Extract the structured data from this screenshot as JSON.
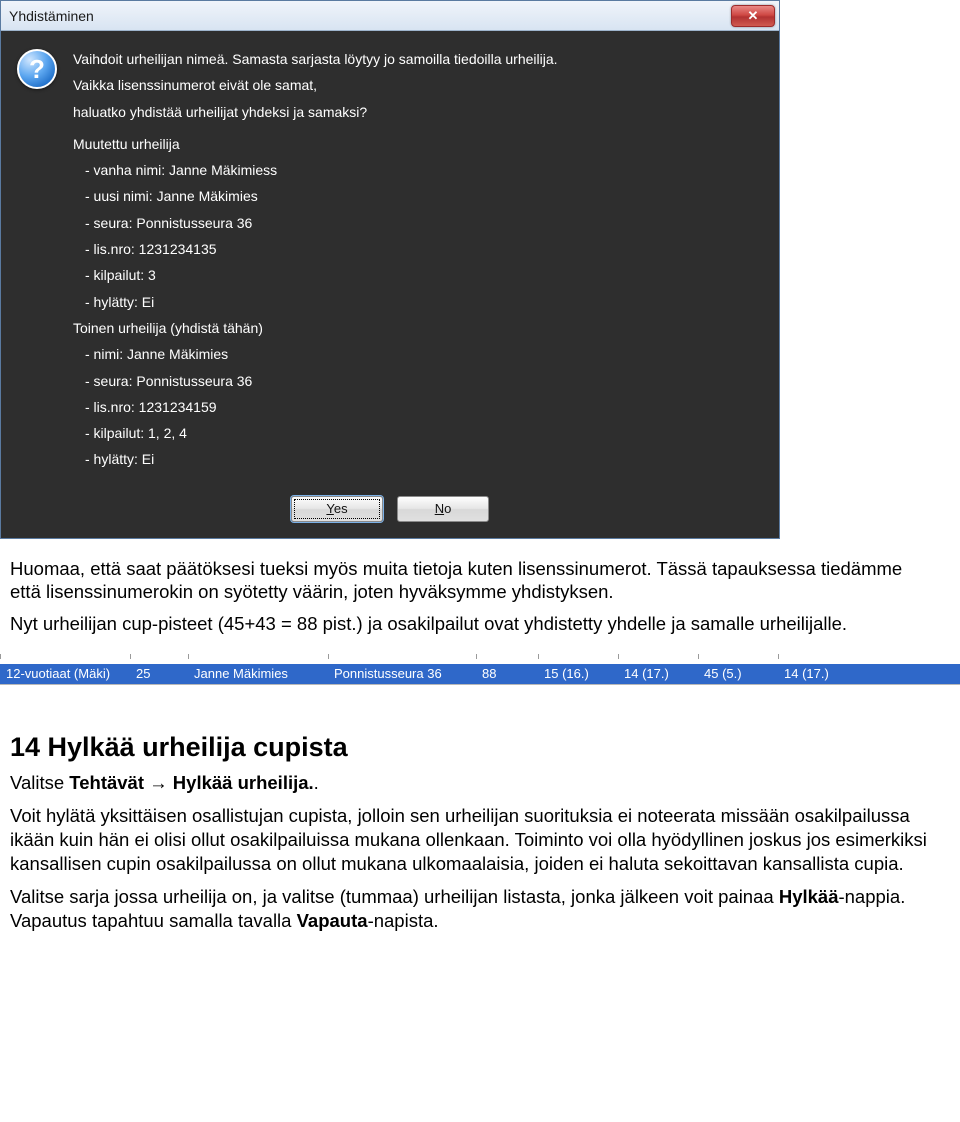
{
  "dialog": {
    "title": "Yhdistäminen",
    "close_glyph": "✕",
    "question_glyph": "?",
    "lines": {
      "intro1": "Vaihdoit urheilijan nimeä. Samasta sarjasta löytyy jo samoilla tiedoilla urheilija.",
      "intro2": "Vaikka lisenssinumerot eivät ole samat,",
      "intro3": "haluatko yhdistää urheilijat yhdeksi ja samaksi?",
      "header1": "Muutettu urheilija",
      "a_old": "- vanha nimi: Janne Mäkimiess",
      "a_new": "- uusi nimi: Janne Mäkimies",
      "a_club": "- seura: Ponnistusseura 36",
      "a_lic": "- lis.nro: 1231234135",
      "a_comp": "- kilpailut: 3",
      "a_rej": "- hylätty: Ei",
      "header2": "Toinen urheilija (yhdistä tähän)",
      "b_name": "- nimi: Janne Mäkimies",
      "b_club": "- seura: Ponnistusseura 36",
      "b_lic": "- lis.nro: 1231234159",
      "b_comp": "- kilpailut: 1, 2, 4",
      "b_rej": "- hylätty: Ei"
    },
    "buttons": {
      "yes": "Yes",
      "no": "No"
    }
  },
  "prose1": {
    "p1": "Huomaa, että saat päätöksesi tueksi myös muita tietoja kuten lisenssinumerot. Tässä tapauksessa tiedämme että lisenssinumerokin on syötetty väärin, joten hyväksymme yhdistyksen.",
    "p2": "Nyt urheilijan cup-pisteet (45+43 = 88 pist.) ja osakilpailut ovat yhdistetty yhdelle ja samalle urheilijalle."
  },
  "row": {
    "series": "12-vuotiaat (Mäki)",
    "num": "25",
    "name": "Janne Mäkimies",
    "club": "Ponnistusseura 36",
    "pts": "88",
    "r1": "15 (16.)",
    "r2": "14 (17.)",
    "r3": "45 (5.)",
    "r4": "14 (17.)"
  },
  "section": {
    "heading": "14  Hylkää urheilija cupista",
    "menu_prefix": "Valitse ",
    "menu_b1": "Tehtävät",
    "menu_arrow": " → ",
    "menu_b2": "Hylkää urheilija.",
    "menu_suffix": ".",
    "p1": "Voit hylätä yksittäisen osallistujan cupista, jolloin sen urheilijan suorituksia ei noteerata missään osakilpailussa ikään kuin hän ei olisi ollut osakilpailuissa mukana ollenkaan. Toiminto voi olla hyödyllinen joskus jos esimerkiksi kansallisen cupin osakilpailussa on ollut mukana ulkomaalaisia, joiden ei haluta sekoittavan kansallista cupia.",
    "p2_a": "Valitse sarja jossa urheilija on, ja valitse (tummaa) urheilijan listasta, jonka jälkeen voit painaa ",
    "p2_b1": "Hylkää",
    "p2_mid": "-nappia. Vapautus tapahtuu samalla tavalla ",
    "p2_b2": "Vapauta",
    "p2_end": "-napista."
  }
}
